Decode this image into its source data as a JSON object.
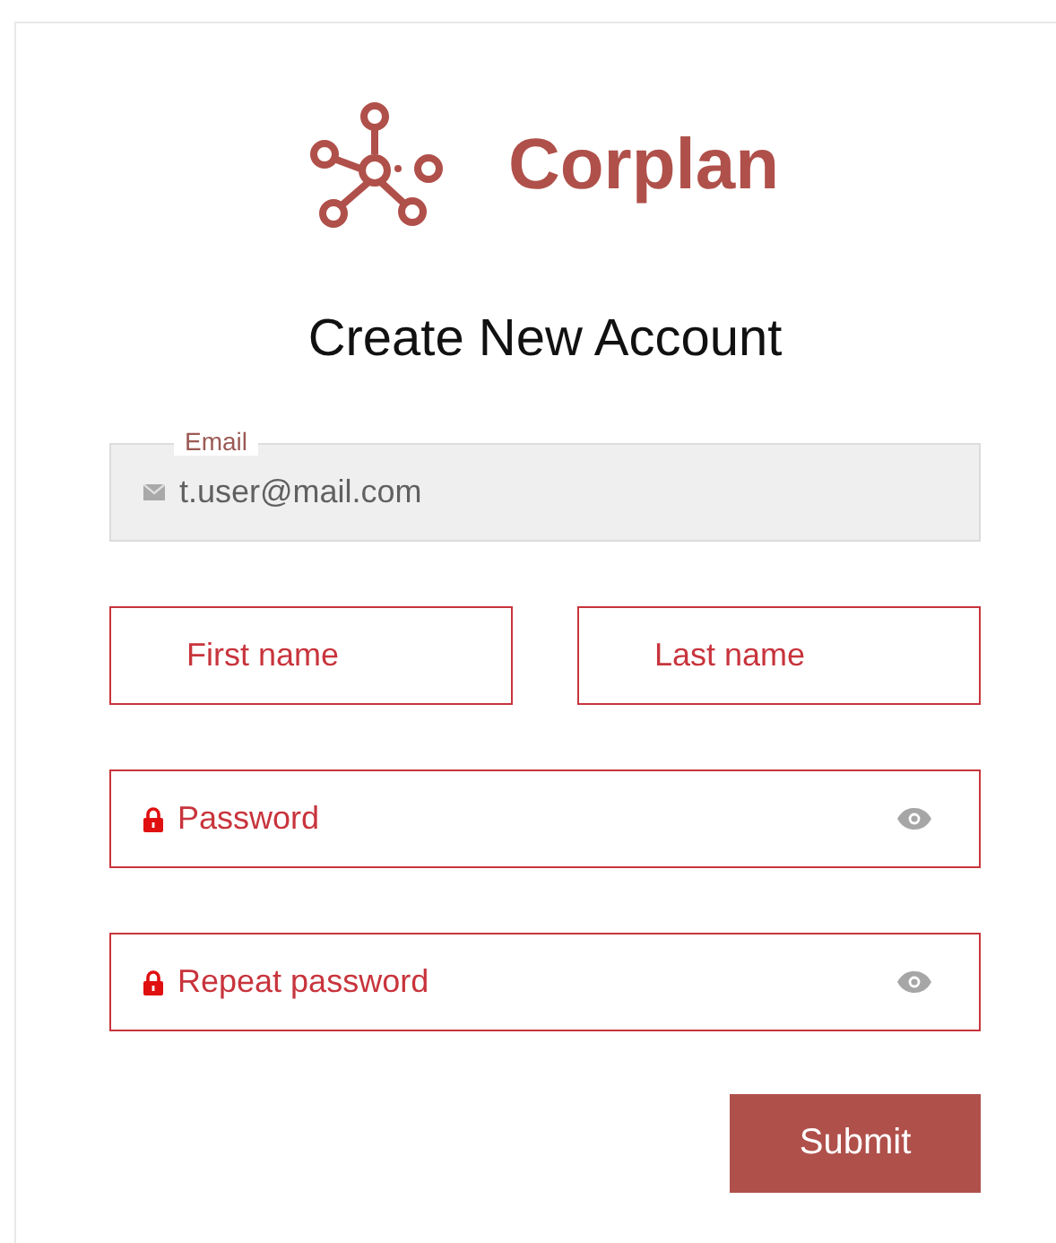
{
  "brand": {
    "name": "Corplan"
  },
  "title": "Create New Account",
  "fields": [
    {
      "kind": "email",
      "label": "Email",
      "value": "t.user@mail.com",
      "disabled": true,
      "invalid": false
    },
    {
      "kind": "name",
      "placeholder": "First name",
      "disabled": false,
      "invalid": true
    },
    {
      "kind": "name",
      "placeholder": "Last name",
      "disabled": false,
      "invalid": true
    },
    {
      "kind": "password",
      "placeholder": "Password",
      "disabled": false,
      "invalid": true
    },
    {
      "kind": "password",
      "placeholder": "Repeat password",
      "disabled": false,
      "invalid": true
    }
  ],
  "buttons": [
    "Submit"
  ]
}
